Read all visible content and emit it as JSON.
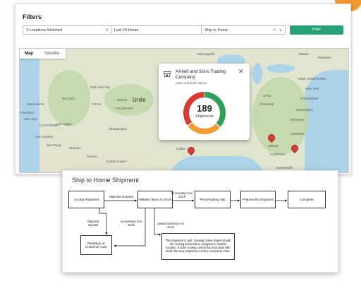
{
  "filters": {
    "title": "Filters",
    "locations_value": "3 Locations Selected",
    "time_value": "Last 24 Hours",
    "type_value": "Ship to Home",
    "button_label": "Filter",
    "clear_glyph": "×",
    "chevron_glyph": "∨"
  },
  "map": {
    "tabs": [
      "Map",
      "Satellite"
    ],
    "labels": {
      "minneapolis": "Minneapolis",
      "ottawa": "Ottawa",
      "montreal": "Montreal",
      "salt_lake_city": "Salt Lake City",
      "nevada": "NEVADA",
      "sacramento": "Sacramento",
      "francisco": "Francisco",
      "san_jose": "San Jose",
      "las_vegas": "Las Vegas",
      "los_angeles": "Los Angeles",
      "san_diego": "San Diego",
      "phoenix": "Phoenix",
      "tucson": "Tucson",
      "ciudad_juarez": "Ciudad Juárez",
      "denver": "Denver",
      "unite": "Unite",
      "colorado": "COLORADO",
      "albuquerque": "Albuquerque",
      "dallas": "Dallas",
      "missouri": "MISSOURI",
      "new_york": "New York",
      "new_hampshire": "NEW HAMPSHIRE",
      "philadelphia": "Philadelphia",
      "cincinnati": "Cincinnati",
      "washington": "Washington",
      "virginia": "VIRGINIA",
      "charlotte": "Charlotte",
      "atlanta": "Atlanta",
      "georgia": "GEORGIA",
      "jacksonville": "Jacksonville",
      "utah": "UTAH",
      "california": "CALIFORNIA",
      "ohio": "OHIO"
    }
  },
  "popup": {
    "name": "Arnleif and Sons Trading Company",
    "address": "2581 Gladwell Street",
    "count": "189",
    "count_label": "Shipments",
    "close_glyph": "✕"
  },
  "donut_data": {
    "segments": [
      {
        "color": "#2e9e5b",
        "fraction": 0.37
      },
      {
        "color": "#f39a32",
        "fraction": 0.28
      },
      {
        "color": "#d93a32",
        "fraction": 0.35
      }
    ]
  },
  "flow": {
    "title": "Ship to Home Shipment",
    "boxes": {
      "accept": "Accept Shipment",
      "validate": "Validate Items in Stock",
      "print": "Print Packing Slip",
      "prepare": "Prepare for Shipment",
      "complete": "Complete",
      "reassign": "Reassign or Customer Care",
      "split": "This shipment is split, creating a new shipment with the missing items that is assigned to another location. If order routing cannot find a location with stock, the new shipment is sent to Customer Care."
    },
    "edges": {
      "accepted": "shipment accepted",
      "all_inventory": "all inventory is in stock",
      "rejected": "shipment rejected",
      "no_inventory": "no inventory is in stock",
      "partial": "partial inventory is in stock"
    }
  },
  "colors": {
    "accent": "#27a17a",
    "orange": "#f39a32",
    "marker": "#d93a32"
  }
}
